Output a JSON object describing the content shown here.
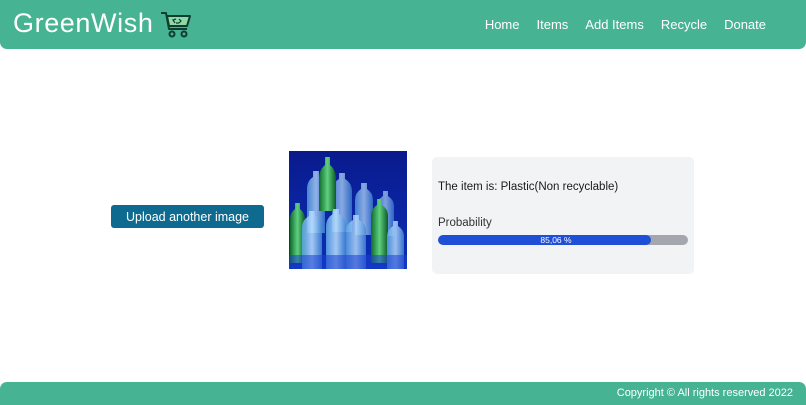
{
  "brand": {
    "name": "GreenWish",
    "logo_icon": "cart-recycle-icon"
  },
  "nav": {
    "items": [
      {
        "label": "Home"
      },
      {
        "label": "Items"
      },
      {
        "label": "Add Items"
      },
      {
        "label": "Recycle"
      },
      {
        "label": "Donate"
      }
    ]
  },
  "upload": {
    "label": "Upload another image"
  },
  "result": {
    "title": "The item is: Plastic(Non recyclable)",
    "probability_label": "Probability",
    "probability_text": "85,06 %",
    "probability_value": 0.8506
  },
  "footer": {
    "copyright": "Copyright © All rights reserved 2022"
  },
  "colors": {
    "brand_green": "#46b393",
    "button_blue": "#0f6a8f",
    "progress_fill": "#1e4fd6",
    "progress_track": "#a4a7ad"
  }
}
